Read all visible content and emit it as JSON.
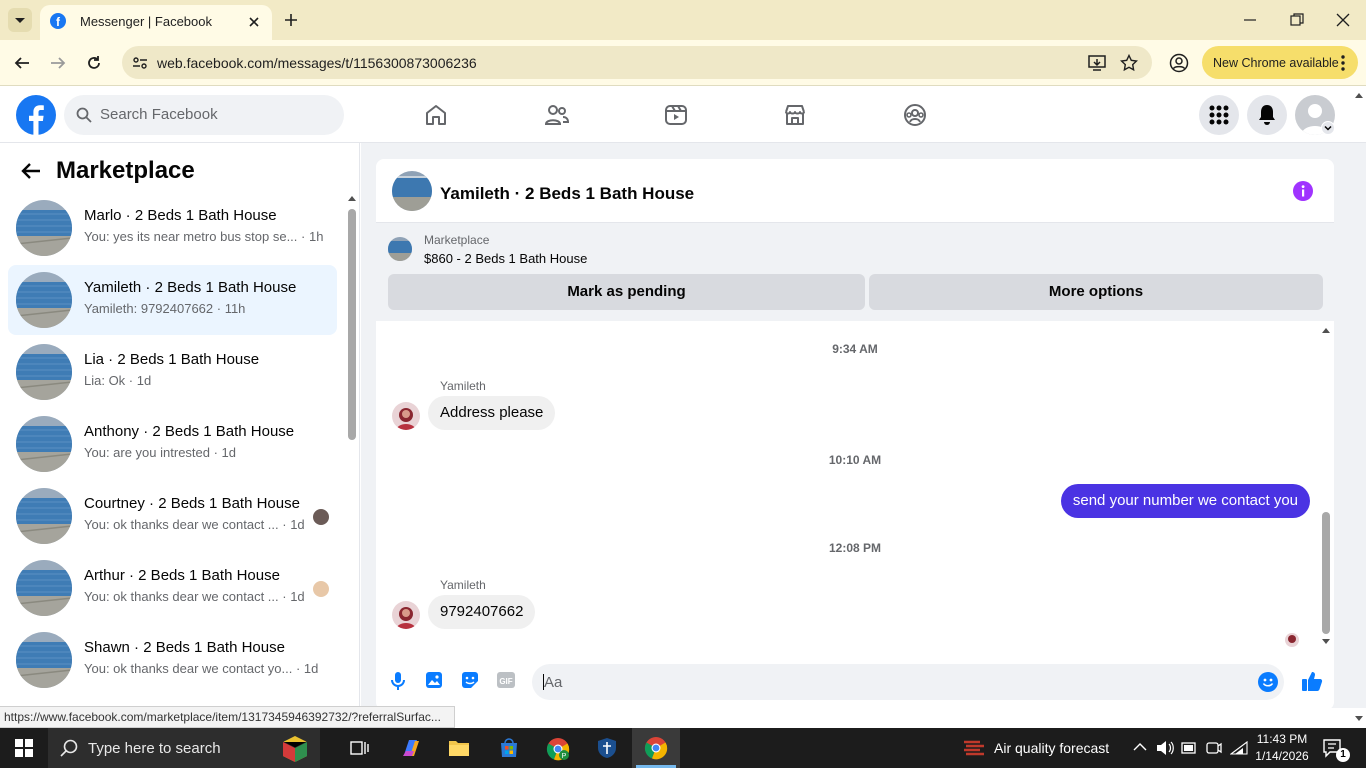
{
  "browser": {
    "tab_title": "Messenger | Facebook",
    "url": "web.facebook.com/messages/t/1156300873006236",
    "update_label": "New Chrome available",
    "status_url": "https://www.facebook.com/marketplace/item/1317345946392732/?referralSurfac..."
  },
  "header": {
    "search_placeholder": "Search Facebook",
    "brand_color": "#1877f2"
  },
  "sidebar": {
    "title": "Marketplace",
    "conversations": [
      {
        "name": "Marlo · 2 Beds 1 Bath House",
        "preview": "You: yes its near metro bus stop se... · 1h",
        "active": false
      },
      {
        "name": "Yamileth · 2 Beds 1 Bath House",
        "preview": "Yamileth: 9792407662 · 11h",
        "active": true
      },
      {
        "name": "Lia · 2 Beds 1 Bath House",
        "preview": "Lia: Ok · 1d",
        "active": false
      },
      {
        "name": "Anthony · 2 Beds 1 Bath House",
        "preview": "You: are you intrested · 1d",
        "active": false
      },
      {
        "name": "Courtney · 2 Beds 1 Bath House",
        "preview": "You: ok thanks dear we contact ... · 1d",
        "active": false
      },
      {
        "name": "Arthur · 2 Beds 1 Bath House",
        "preview": "You: ok thanks dear we contact ... · 1d",
        "active": false
      },
      {
        "name": "Shawn · 2 Beds 1 Bath House",
        "preview": "You: ok thanks dear we contact yo... · 1d",
        "active": false
      }
    ]
  },
  "chat": {
    "title": "Yamileth · 2 Beds 1 Bath House",
    "listing_source": "Marketplace",
    "listing_title": "$860 - 2 Beds 1 Bath House",
    "mark_pending_label": "Mark as pending",
    "more_options_label": "More options",
    "messages": [
      {
        "time": "9:34 AM",
        "sender": "Yamileth",
        "text": "Address please",
        "direction": "in"
      },
      {
        "time": "10:10 AM",
        "sender": "",
        "text": "send your number we contact you",
        "direction": "out"
      },
      {
        "time": "12:08 PM",
        "sender": "Yamileth",
        "text": "9792407662",
        "direction": "in"
      }
    ],
    "composer_placeholder": "Aa",
    "accent_color": "#4a33e3"
  },
  "taskbar": {
    "search_placeholder": "Type here to search",
    "weather": "Air quality forecast",
    "time": "11:43 PM",
    "date": "1/14/2026",
    "notification_count": "1"
  }
}
